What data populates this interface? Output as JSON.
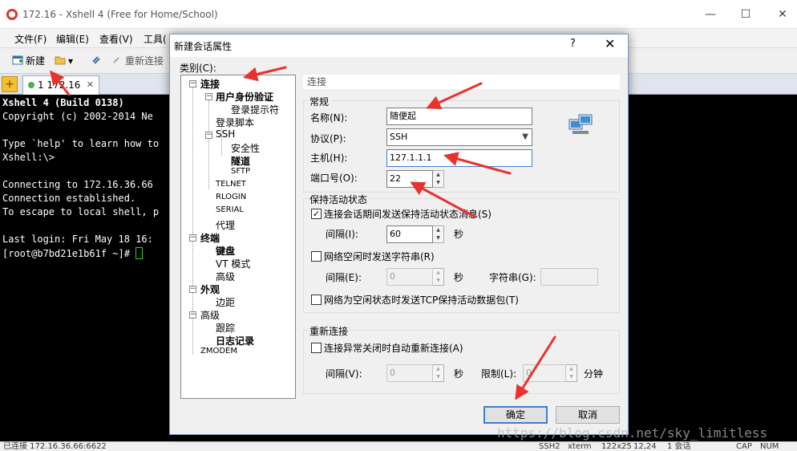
{
  "window": {
    "title": "172.16 - Xshell 4 (Free for Home/School)",
    "minimize": "—",
    "maximize": "☐",
    "close": "✕"
  },
  "menu": [
    "文件(F)",
    "编辑(E)",
    "查看(V)",
    "工具("
  ],
  "toolbar": {
    "new_label": "新建",
    "reconnect_label": "重新连接",
    "dropdown_caret": "▾"
  },
  "tabs": {
    "add": "+",
    "active_label": "1 172.16",
    "close": "✕"
  },
  "terminal": {
    "lines": [
      "Xshell 4 (Build 0138)",
      "Copyright (c) 2002-2014 Ne",
      "",
      "Type `help' to learn how to",
      "Xshell:\\>",
      "",
      "Connecting to 172.16.36.66",
      "Connection established.",
      "To escape to local shell, p",
      "",
      "Last login: Fri May 18 16:",
      "[root@b7bd21e1b61f ~]# "
    ]
  },
  "status": {
    "left": "已连接 172.16.36.66:6622",
    "proto": "SSH2",
    "term": "xterm",
    "size": "122x25",
    "pos": "12,24",
    "sessions": "1 会话",
    "cap": "CAP",
    "num": "NUM"
  },
  "dialog": {
    "title": "新建会话属性",
    "help": "?",
    "close": "✕",
    "category_label": "类别(C):",
    "tree": [
      {
        "label": "连接",
        "bold": true,
        "expander": "−"
      },
      {
        "label": "用户身份验证",
        "bold": true,
        "expander": "−"
      },
      {
        "label": "登录提示符",
        "bold": false
      },
      {
        "label": "登录脚本",
        "bold": false
      },
      {
        "label": "SSH",
        "bold": false,
        "expander": "−"
      },
      {
        "label": "安全性",
        "bold": false
      },
      {
        "label": "隧道",
        "bold": true
      },
      {
        "label": "SFTP",
        "bold": false
      },
      {
        "label": "TELNET",
        "bold": false
      },
      {
        "label": "RLOGIN",
        "bold": false
      },
      {
        "label": "SERIAL",
        "bold": false
      },
      {
        "label": "代理",
        "bold": false
      },
      {
        "label": "终端",
        "bold": true,
        "expander": "−"
      },
      {
        "label": "键盘",
        "bold": true
      },
      {
        "label": "VT 模式",
        "bold": false
      },
      {
        "label": "高级",
        "bold": false
      },
      {
        "label": "外观",
        "bold": true,
        "expander": "−"
      },
      {
        "label": "边距",
        "bold": false
      },
      {
        "label": "高级",
        "bold": false,
        "expander": "−"
      },
      {
        "label": "跟踪",
        "bold": false
      },
      {
        "label": "日志记录",
        "bold": true
      },
      {
        "label": "ZMODEM",
        "bold": false
      }
    ],
    "panel_header": "连接",
    "general": {
      "title": "常规",
      "name_label": "名称(N):",
      "name_value": "随便起",
      "protocol_label": "协议(P):",
      "protocol_value": "SSH",
      "host_label": "主机(H):",
      "host_value": "127.1.1.1",
      "port_label": "端口号(O):",
      "port_value": "22"
    },
    "keepalive": {
      "title": "保持活动状态",
      "send_keepalive_label": "连接会话期间发送保持活动状态消息(S)",
      "send_keepalive_checked": true,
      "interval_label": "间隔(I):",
      "interval_value": "60",
      "seconds": "秒",
      "send_string_label": "网络空闲时发送字符串(R)",
      "send_string_checked": false,
      "string_interval_label": "间隔(E):",
      "string_interval_value": "0",
      "string_label": "字符串(G):",
      "string_value": "",
      "tcp_keepalive_label": "网络为空闲状态时发送TCP保持活动数据包(T)",
      "tcp_keepalive_checked": false
    },
    "reconnect": {
      "title": "重新连接",
      "auto_reconnect_label": "连接异常关闭时自动重新连接(A)",
      "auto_reconnect_checked": false,
      "interval_label": "间隔(V):",
      "interval_value": "0",
      "seconds": "秒",
      "limit_label": "限制(L):",
      "limit_value": "0",
      "minutes": "分钟"
    },
    "ok_label": "确定",
    "cancel_label": "取消"
  },
  "watermark": "https://blog.csdn.net/sky_limitless",
  "colors": {
    "annotation_arrow": "#e8322d",
    "terminal_bg": "#000000",
    "cursor": "#2ad02a",
    "focus_border": "#3c7fd0"
  }
}
